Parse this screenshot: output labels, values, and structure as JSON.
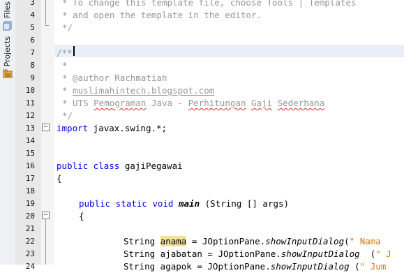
{
  "side_tabs": [
    {
      "label": "Files",
      "icon": "files-icon"
    },
    {
      "label": "Projects",
      "icon": "projects-icon"
    }
  ],
  "line_numbers": [
    "3",
    "4",
    "5",
    "6",
    "7",
    "8",
    "9",
    "10",
    "11",
    "12",
    "13",
    "14",
    "15",
    "16",
    "17",
    "18",
    "19",
    "20",
    "21",
    "22",
    "23",
    "24"
  ],
  "code": {
    "l3": "* To change this template file, choose Tools | Templates",
    "l4": "* and open the template in the editor.",
    "l5": "*/",
    "l7": "/**",
    "l8": "*",
    "l9_tag": "* @author ",
    "l9_name": "Rachmatiah",
    "l10_pre": "* ",
    "l10_link": "muslimahintech.blogspot.com",
    "l11_a": "* UTS ",
    "l11_b": "Pemograman",
    "l11_c": " Java - ",
    "l11_d": "Perhitungan",
    "l11_e": " ",
    "l11_f": "Gaji",
    "l11_g": " ",
    "l11_h": "Sederhana",
    "l12": "*/",
    "l13_kw": "import",
    "l13_rest": " javax.swing.*;",
    "l16_kw": "public class",
    "l16_rest": " gajiPegawai",
    "l17": "{",
    "l19_kw": "public static void",
    "l19_main": "main",
    "l19_rest": " (String [] args)",
    "l20": "{",
    "l22_a": "String ",
    "l22_var": "anama",
    "l22_b": " = JOptionPane.",
    "l22_m": "showInputDialog",
    "l22_c": "(",
    "l22_s": "\" Nama",
    "l23_a": "String ajabatan = JOptionPane.",
    "l23_m": "showInputDialog",
    "l23_c": "  (",
    "l23_s": "\" J",
    "l24_a": "String agapok = JOptionPane.",
    "l24_m": "showInputDialog",
    "l24_c": " (",
    "l24_s": "\" Jum"
  },
  "colors": {
    "keyword": "#0000e6",
    "comment": "#969696",
    "string": "#ce7b00",
    "highlight": "#f3e39a"
  }
}
